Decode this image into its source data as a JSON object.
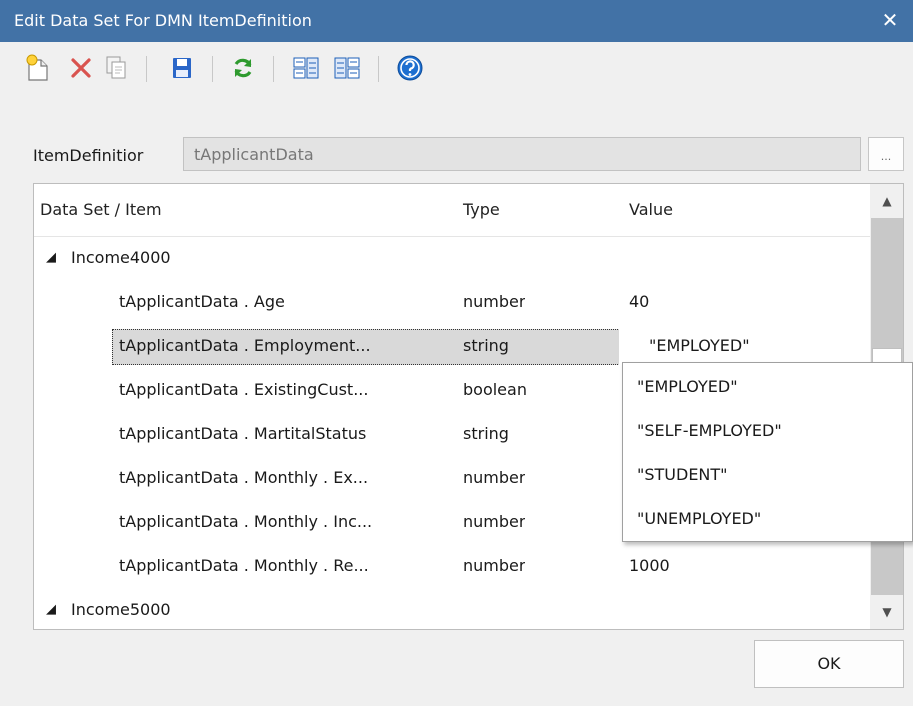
{
  "window": {
    "title": "Edit Data Set For DMN ItemDefinition",
    "close_glyph": "✕"
  },
  "toolbar": {
    "buttons": [
      {
        "name": "new-icon"
      },
      {
        "name": "delete-icon"
      },
      {
        "name": "copy-icon"
      },
      {
        "name": "save-icon"
      },
      {
        "name": "refresh-icon"
      },
      {
        "name": "import-icon"
      },
      {
        "name": "export-icon"
      },
      {
        "name": "help-icon"
      }
    ]
  },
  "item_definition": {
    "label": "ItemDefinitior",
    "value": "tApplicantData",
    "browse_label": "..."
  },
  "grid": {
    "columns": [
      "Data Set / Item",
      "Type",
      "Value"
    ],
    "groups": [
      {
        "name": "Income4000",
        "expanded": true,
        "rows": [
          {
            "item": "tApplicantData . Age",
            "type": "number",
            "value": "40"
          },
          {
            "item": "tApplicantData . Employment...",
            "type": "string",
            "value": "\"EMPLOYED\"",
            "selected": true
          },
          {
            "item": "tApplicantData . ExistingCust...",
            "type": "boolean",
            "value": ""
          },
          {
            "item": "tApplicantData . MartitalStatus",
            "type": "string",
            "value": ""
          },
          {
            "item": "tApplicantData . Monthly . Ex...",
            "type": "number",
            "value": ""
          },
          {
            "item": "tApplicantData . Monthly . Inc...",
            "type": "number",
            "value": ""
          },
          {
            "item": "tApplicantData . Monthly . Re...",
            "type": "number",
            "value": "1000"
          }
        ]
      },
      {
        "name": "Income5000",
        "expanded": true,
        "rows": []
      }
    ]
  },
  "dropdown": {
    "options": [
      "\"EMPLOYED\"",
      "\"SELF-EMPLOYED\"",
      "\"STUDENT\"",
      "\"UNEMPLOYED\""
    ]
  },
  "buttons": {
    "ok_label": "OK"
  },
  "colors": {
    "titlebar": "#4272a6",
    "accent_green": "#2e9a2e",
    "delete_red": "#d9534f",
    "save_blue": "#2a66c8",
    "help_blue": "#1e6fd0"
  }
}
